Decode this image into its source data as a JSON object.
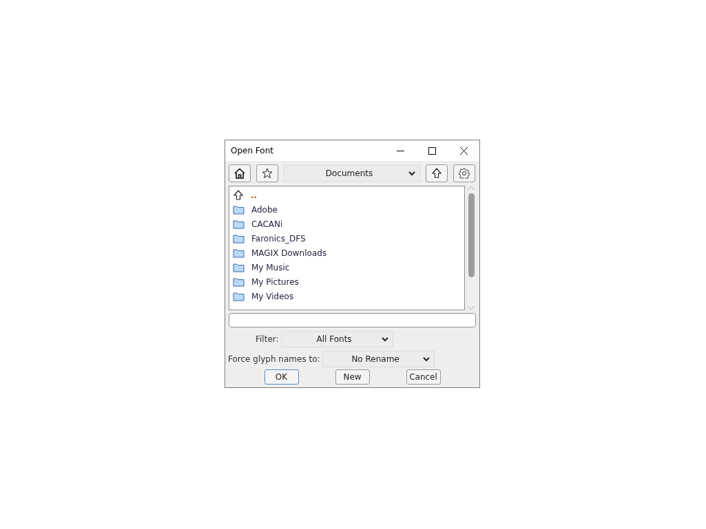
{
  "window": {
    "title": "Open Font"
  },
  "toolbar": {
    "location": "Documents"
  },
  "files": [
    {
      "kind": "parent",
      "name": ".."
    },
    {
      "kind": "folder",
      "name": "Adobe"
    },
    {
      "kind": "folder",
      "name": "CACANi"
    },
    {
      "kind": "folder",
      "name": "Faronics_DFS"
    },
    {
      "kind": "folder",
      "name": "MAGIX Downloads"
    },
    {
      "kind": "folder",
      "name": "My Music"
    },
    {
      "kind": "folder",
      "name": "My Pictures"
    },
    {
      "kind": "folder",
      "name": "My Videos"
    }
  ],
  "filter": {
    "label": "Filter:",
    "value": "All Fonts"
  },
  "rename": {
    "label": "Force glyph names to:",
    "value": "No Rename"
  },
  "buttons": [
    {
      "label": "OK",
      "default": true
    },
    {
      "label": "New",
      "default": false
    },
    {
      "label": "Cancel",
      "default": false
    }
  ]
}
